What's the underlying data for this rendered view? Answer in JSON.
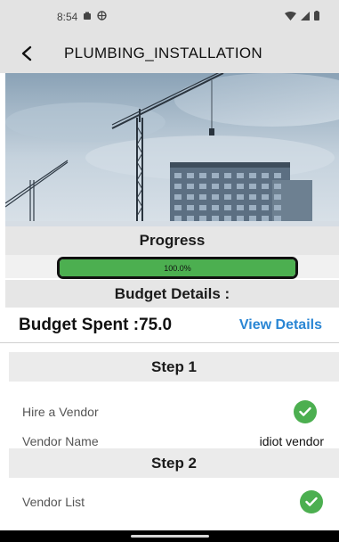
{
  "status_bar": {
    "time": "8:54",
    "icons": [
      "notification-icon",
      "vpn-icon",
      "wifi-icon",
      "signal-icon",
      "battery-icon"
    ]
  },
  "app_bar": {
    "back_icon": "back-chevron-icon",
    "title": "PLUMBING_INSTALLATION"
  },
  "hero": {
    "image": "construction-crane-building-image"
  },
  "progress": {
    "heading": "Progress",
    "value_percent": 100.0,
    "label": "100.0%"
  },
  "budget": {
    "heading": "Budget Details :",
    "spent_label": "Budget Spent :75.0",
    "view_details_label": "View Details"
  },
  "steps": [
    {
      "title": "Step 1",
      "rows": [
        {
          "label": "Hire a Vendor",
          "status_icon": "check-circle-icon"
        },
        {
          "label": "Vendor Name",
          "value": "idiot vendor"
        }
      ]
    },
    {
      "title": "Step 2",
      "rows": [
        {
          "label": "Vendor List",
          "status_icon": "check-circle-icon"
        }
      ]
    }
  ],
  "colors": {
    "accent_green": "#4caf50",
    "link_blue": "#2a86d4",
    "band_gray": "#e6e6e6",
    "app_bar_gray": "#e3e3e3"
  }
}
